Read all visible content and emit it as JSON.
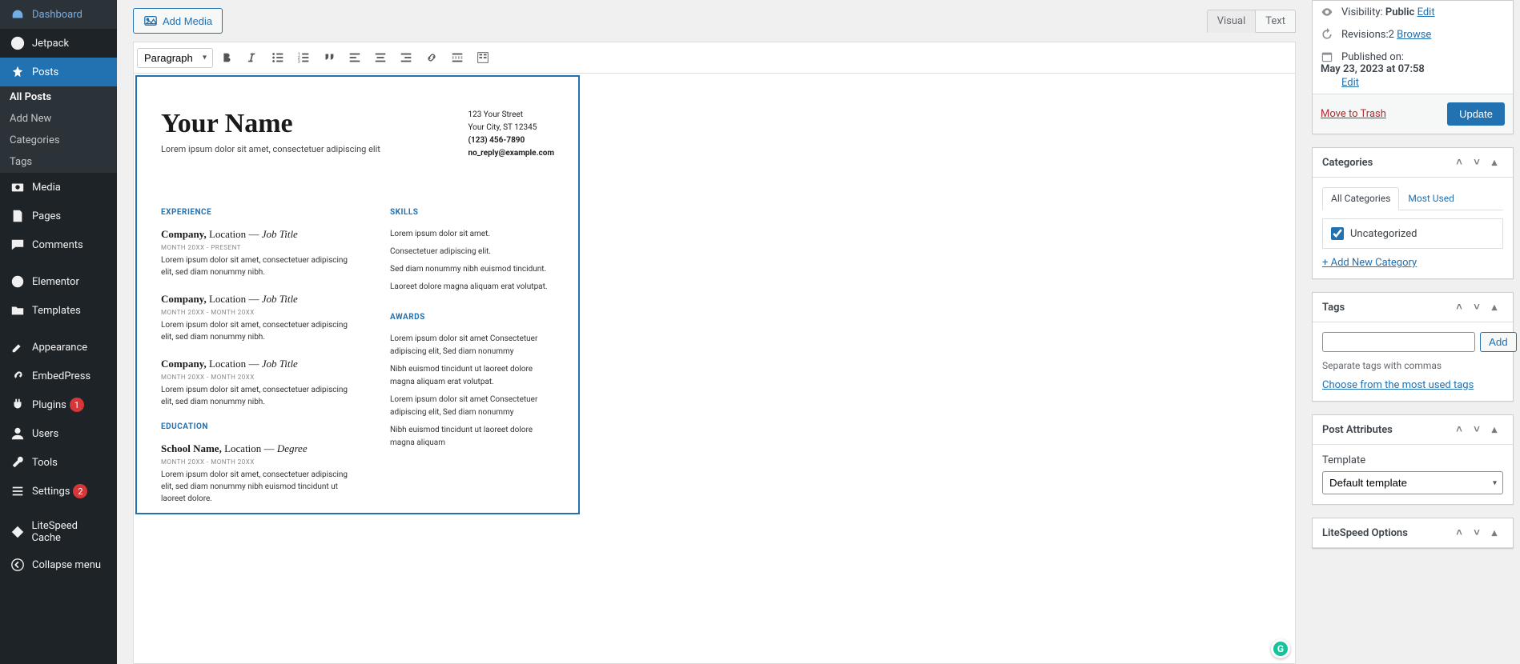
{
  "sidebar": {
    "items": [
      {
        "label": "Dashboard"
      },
      {
        "label": "Jetpack"
      },
      {
        "label": "Posts"
      },
      {
        "label": "Media"
      },
      {
        "label": "Pages"
      },
      {
        "label": "Comments"
      },
      {
        "label": "Elementor"
      },
      {
        "label": "Templates"
      },
      {
        "label": "Appearance"
      },
      {
        "label": "EmbedPress"
      },
      {
        "label": "Plugins"
      },
      {
        "label": "Users"
      },
      {
        "label": "Tools"
      },
      {
        "label": "Settings"
      },
      {
        "label": "LiteSpeed Cache"
      },
      {
        "label": "Collapse menu"
      }
    ],
    "postsSub": [
      "All Posts",
      "Add New",
      "Categories",
      "Tags"
    ],
    "pluginsBadge": "1",
    "settingsBadge": "2"
  },
  "editor": {
    "addMedia": "Add Media",
    "tabs": {
      "visual": "Visual",
      "text": "Text"
    },
    "formatSelect": "Paragraph"
  },
  "doc": {
    "name": "Your Name",
    "tagline": "Lorem ipsum dolor sit amet, consectetuer adipiscing elit",
    "contact": {
      "street": "123 Your Street",
      "city": "Your City, ST 12345",
      "phone": "(123) 456-7890",
      "email": "no_reply@example.com"
    },
    "expTitle": "EXPERIENCE",
    "exp": [
      {
        "company": "Company,",
        "loc": " Location ",
        "dash": "— ",
        "title": "Job Title",
        "dates": "MONTH 20XX - PRESENT",
        "desc": "Lorem ipsum dolor sit amet, consectetuer adipiscing elit, sed diam nonummy nibh."
      },
      {
        "company": "Company,",
        "loc": " Location ",
        "dash": "— ",
        "title": "Job Title",
        "dates": "MONTH 20XX - MONTH 20XX",
        "desc": "Lorem ipsum dolor sit amet, consectetuer adipiscing elit, sed diam nonummy nibh."
      },
      {
        "company": "Company,",
        "loc": " Location ",
        "dash": "— ",
        "title": "Job Title",
        "dates": "MONTH 20XX - MONTH 20XX",
        "desc": "Lorem ipsum dolor sit amet, consectetuer adipiscing elit, sed diam nonummy nibh."
      }
    ],
    "eduTitle": "EDUCATION",
    "edu": {
      "school": "School Name,",
      "loc": " Location ",
      "dash": "— ",
      "title": "Degree",
      "dates": "MONTH 20XX - MONTH 20XX",
      "desc": "Lorem ipsum dolor sit amet, consectetuer adipiscing elit, sed diam nonummy nibh euismod tincidunt ut laoreet dolore."
    },
    "skillsTitle": "SKILLS",
    "skills": [
      "Lorem ipsum dolor sit amet.",
      "Consectetuer adipiscing elit.",
      "Sed diam nonummy nibh euismod tincidunt.",
      "Laoreet dolore magna aliquam erat volutpat."
    ],
    "awardsTitle": "AWARDS",
    "awards": [
      "Lorem ipsum dolor sit amet Consectetuer adipiscing elit, Sed diam nonummy",
      "Nibh euismod tincidunt ut laoreet dolore magna aliquam erat volutpat.",
      "Lorem ipsum dolor sit amet Consectetuer adipiscing elit, Sed diam nonummy",
      "Nibh euismod tincidunt ut laoreet dolore magna aliquam"
    ]
  },
  "publish": {
    "visibilityLabel": "Visibility: ",
    "visibilityValue": "Public",
    "visibilityEdit": "Edit",
    "revisionsLabel": "Revisions: ",
    "revisionsCount": "2",
    "browse": "Browse",
    "publishedLabel": "Published on: ",
    "publishedValue": "May 23, 2023 at 07:58",
    "edit": "Edit",
    "trash": "Move to Trash",
    "update": "Update"
  },
  "categories": {
    "title": "Categories",
    "tabAll": "All Categories",
    "tabMost": "Most Used",
    "uncategorized": "Uncategorized",
    "addNew": "+ Add New Category"
  },
  "tags": {
    "title": "Tags",
    "add": "Add",
    "help": "Separate tags with commas",
    "choose": "Choose from the most used tags"
  },
  "attrs": {
    "title": "Post Attributes",
    "templateLabel": "Template",
    "templateValue": "Default template"
  },
  "litespeed": {
    "title": "LiteSpeed Options"
  },
  "grammarly": "G"
}
